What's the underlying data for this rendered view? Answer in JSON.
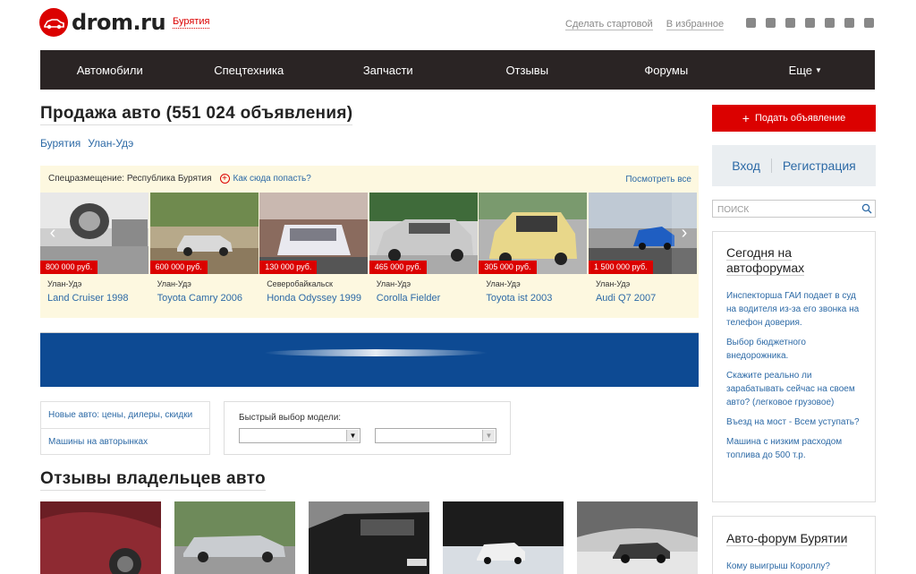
{
  "header": {
    "logo_text": "drom.ru",
    "region": "Бурятия",
    "make_start": "Сделать стартовой",
    "to_favorites": "В избранное",
    "socials": [
      "vk-icon",
      "odnoklassniki-icon",
      "facebook-icon",
      "google-plus-icon",
      "twitter-icon",
      "instagram-icon",
      "youtube-icon"
    ]
  },
  "nav": {
    "items": [
      "Автомобили",
      "Спецтехника",
      "Запчасти",
      "Отзывы",
      "Форумы",
      "Еще"
    ]
  },
  "main": {
    "title": "Продажа авто (551 024 объявления)",
    "breadcrumbs": [
      "Бурятия",
      "Улан-Удэ"
    ]
  },
  "special": {
    "label": "Спецразмещение: Республика Бурятия",
    "how_link": "Как сюда попасть?",
    "see_all": "Посмотреть все",
    "cars": [
      {
        "price": "800 000 руб.",
        "city": "Улан-Удэ",
        "model": "Land Cruiser 1998"
      },
      {
        "price": "600 000 руб.",
        "city": "Улан-Удэ",
        "model": "Toyota Camry 2006"
      },
      {
        "price": "130 000 руб.",
        "city": "Северобайкальск",
        "model": "Honda Odyssey 1999"
      },
      {
        "price": "465 000 руб.",
        "city": "Улан-Удэ",
        "model": "Corolla Fielder"
      },
      {
        "price": "305 000 руб.",
        "city": "Улан-Удэ",
        "model": "Toyota ist 2003"
      },
      {
        "price": "1 500 000 руб.",
        "city": "Улан-Удэ",
        "model": "Audi Q7 2007"
      }
    ]
  },
  "links": {
    "new_cars": "Новые авто: цены, дилеры, скидки",
    "markets": "Машины на авторынках"
  },
  "quick_select": {
    "label": "Быстрый выбор модели:"
  },
  "reviews": {
    "title": "Отзывы владельцев авто"
  },
  "sidebar": {
    "post_ad": "Подать объявление",
    "login": "Вход",
    "register": "Регистрация",
    "search_placeholder": "ПОИСК",
    "forum_title": "Сегодня на автофорумах",
    "forum_items": [
      "Инспекторша ГАИ подает в суд на водителя из-за его звонка на телефон доверия.",
      "Выбор бюджетного внедорожника.",
      "Скажите реально ли зарабатывать сейчас на своем авто? (легковое грузовое)",
      "Въезд на мост - Всем уступать?",
      "Машина с низким расходом топлива до 500 т.р."
    ],
    "forum2_title": "Авто-форум Бурятии",
    "forum2_item": "Кому выигрыш Короллу?"
  },
  "colors": {
    "accent": "#db0100",
    "nav_bg": "#2a2424",
    "link": "#2d6aa6",
    "special_bg": "#fdf8e0",
    "banner": "#0d4a93"
  }
}
